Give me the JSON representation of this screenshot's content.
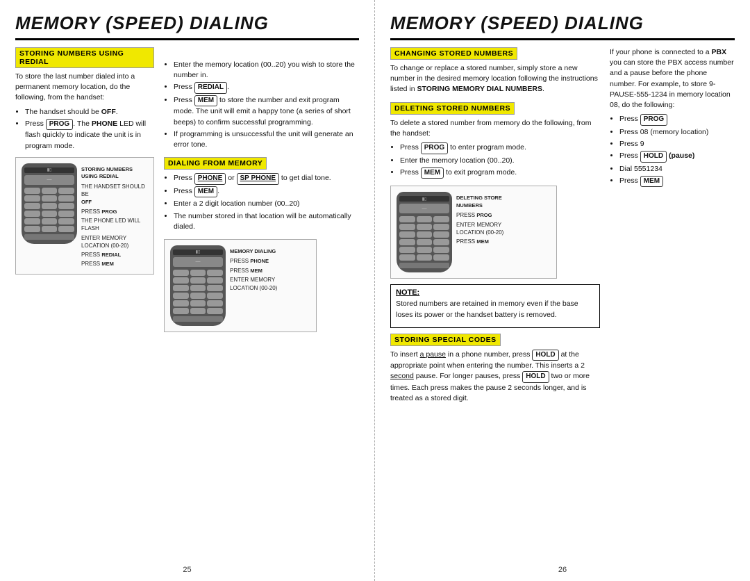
{
  "left_page": {
    "title": "MEMORY (SPEED) DIALING",
    "section1": {
      "header": "STORING NUMBERS USING REDIAL",
      "intro": "To store the last number dialed into a permanent memory location, do the following, from the handset:",
      "bullets": [
        "The handset should be OFF.",
        "Press PROG. The PHONE LED will flash quickly to indicate the unit is in program mode."
      ],
      "steps": [
        "Enter the memory location (00..20) you wish to store the number in.",
        "Press REDIAL.",
        "Press MEM to store the number and exit program mode. The unit will emit a happy tone (a series of short beeps) to confirm successful programming.",
        "If programming is unsuccessful the unit will generate an error tone."
      ]
    },
    "section2": {
      "header": "DIALING FROM MEMORY",
      "steps": [
        "Press PHONE or SP PHONE to get dial tone.",
        "Press MEM.",
        "Enter a 2 digit location number (00..20)",
        "The number stored in that location will be automatically dialed."
      ]
    },
    "diagram1": {
      "label_title": "STORING NUMBERS USING REDIAL",
      "labels": [
        "THE HANDSET SHOULD BE OFF",
        "PRESS PROG",
        "THE PHONE LED WILL FLASH",
        "ENTER MEMORY LOCATION (00-20)",
        "PRESS REDIAL",
        "PRESS MEM"
      ]
    },
    "diagram2": {
      "label_title": "MEMORY DIALING",
      "labels": [
        "PRESS PHONE",
        "PRESS MEM",
        "ENTER MEMORY LOCATION (00-20)"
      ]
    },
    "page_number": "25"
  },
  "right_page": {
    "title": "MEMORY (SPEED) DIALING",
    "section1": {
      "header": "CHANGING STORED NUMBERS",
      "text": "To change or replace a stored number, simply store a new number in the desired memory location following the instructions listed in STORING MEMORY DIAL NUMBERS."
    },
    "section2": {
      "header": "DELETING STORED NUMBERS",
      "intro": "To delete a stored number from memory do the following, from the handset:",
      "steps": [
        "Press PROG to enter program mode.",
        "Enter the memory location (00..20).",
        "Press MEM to exit program mode."
      ]
    },
    "section3": {
      "header": "NOTE:",
      "text": "Stored numbers are retained in memory even if the base loses its power or the handset battery is removed."
    },
    "section4": {
      "header": "STORING SPECIAL CODES",
      "text1": "To insert a pause in a phone number, press HOLD at the appropriate point when entering the number. This inserts a 2 second pause. For longer pauses, press HOLD two or more times. Each press makes the pause 2 seconds longer, and is treated as a stored digit."
    },
    "section5": {
      "intro": "If your phone is connected to a PBX you can store the PBX access number and a pause before the phone number. For example, to store 9-PAUSE-555-1234 in memory location 08, do the following:",
      "steps": [
        "Press PROG",
        "Press 08 (memory location)",
        "Press 9",
        "Press HOLD (pause)",
        "Dial 5551234",
        "Press MEM"
      ]
    },
    "diagram1": {
      "label_title": "DELETING STORE NUMBERS",
      "labels": [
        "PRESS PROG",
        "ENTER MEMORY LOCATION (00-20)",
        "PRESS MEM"
      ]
    },
    "page_number": "26"
  }
}
